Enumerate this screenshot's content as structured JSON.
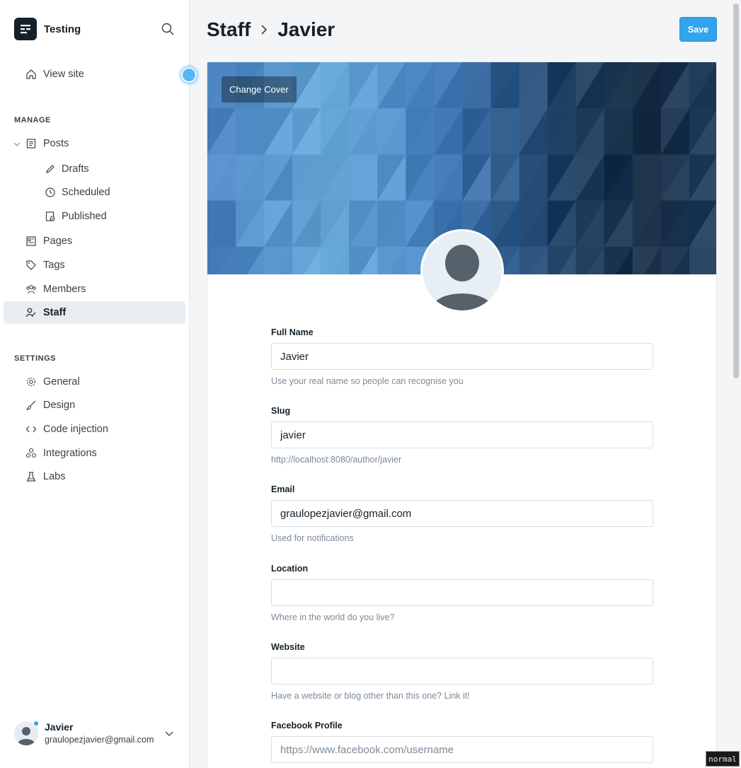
{
  "sidebar": {
    "site_name": "Testing",
    "view_site": "View site",
    "manage_heading": "MANAGE",
    "settings_heading": "SETTINGS",
    "manage_items": [
      {
        "label": "Posts",
        "icon": "posts-icon"
      },
      {
        "label": "Drafts",
        "icon": "pencil-icon"
      },
      {
        "label": "Scheduled",
        "icon": "clock-icon"
      },
      {
        "label": "Published",
        "icon": "published-icon"
      },
      {
        "label": "Pages",
        "icon": "pages-icon"
      },
      {
        "label": "Tags",
        "icon": "tag-icon"
      },
      {
        "label": "Members",
        "icon": "members-icon"
      },
      {
        "label": "Staff",
        "icon": "staff-icon",
        "active": true
      }
    ],
    "settings_items": [
      {
        "label": "General",
        "icon": "gear-icon"
      },
      {
        "label": "Design",
        "icon": "brush-icon"
      },
      {
        "label": "Code injection",
        "icon": "code-icon"
      },
      {
        "label": "Integrations",
        "icon": "integrations-icon"
      },
      {
        "label": "Labs",
        "icon": "flask-icon"
      }
    ],
    "user": {
      "name": "Javier",
      "email": "graulopezjavier@gmail.com"
    }
  },
  "header": {
    "crumb_parent": "Staff",
    "crumb_current": "Javier",
    "save_label": "Save"
  },
  "profile": {
    "change_cover": "Change Cover",
    "fields": {
      "full_name": {
        "label": "Full Name",
        "value": "Javier",
        "hint": "Use your real name so people can recognise you"
      },
      "slug": {
        "label": "Slug",
        "value": "javier",
        "hint": "http://localhost:8080/author/javier"
      },
      "email": {
        "label": "Email",
        "value": "graulopezjavier@gmail.com",
        "hint": "Used for notifications"
      },
      "location": {
        "label": "Location",
        "value": "",
        "hint": "Where in the world do you live?"
      },
      "website": {
        "label": "Website",
        "value": "",
        "hint": "Have a website or blog other than this one? Link it!"
      },
      "facebook": {
        "label": "Facebook Profile",
        "value": "",
        "placeholder": "https://www.facebook.com/username"
      }
    }
  },
  "status": {
    "mode": "normal"
  },
  "colors": {
    "accent": "#30a5ec",
    "text": "#15212a",
    "muted": "#7c8b9a"
  }
}
